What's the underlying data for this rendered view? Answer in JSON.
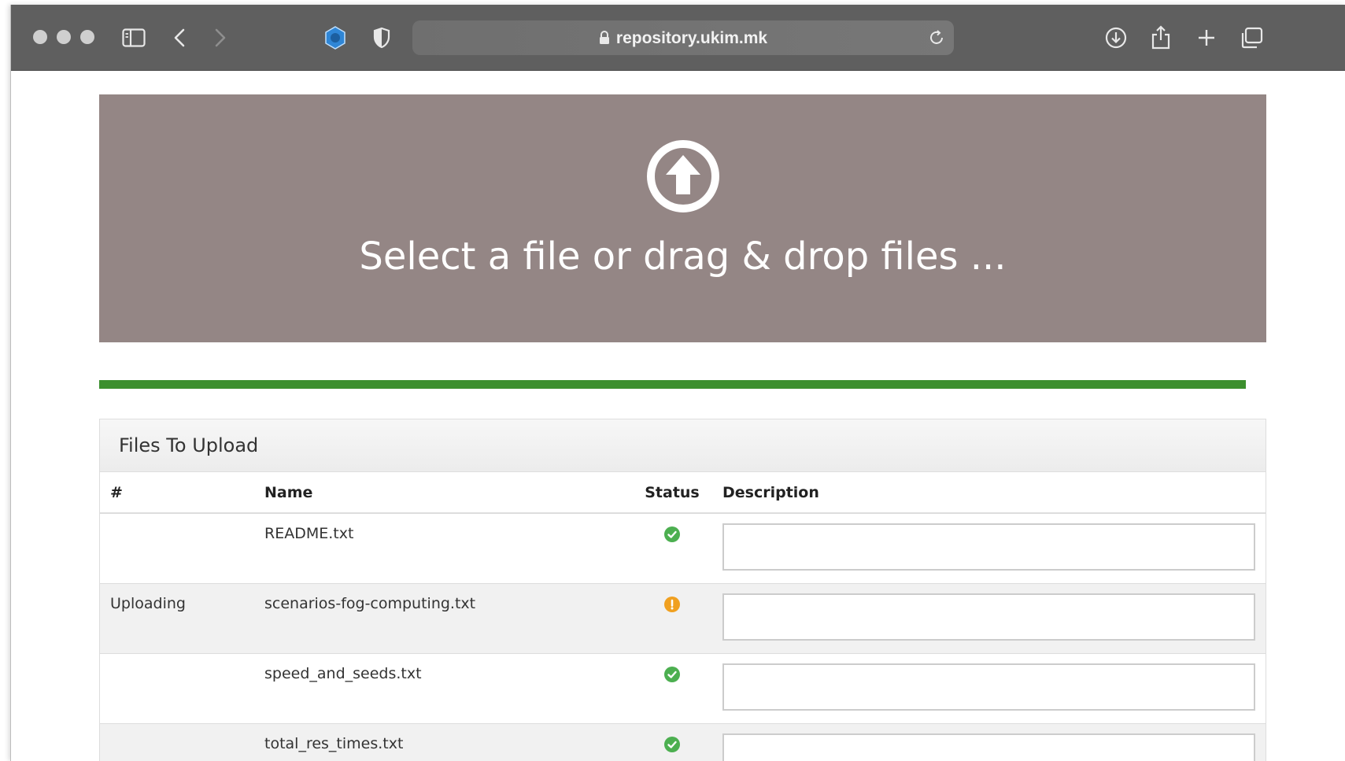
{
  "browser": {
    "url": "repository.ukim.mk",
    "traffic_color": "#cfcfcf"
  },
  "dropzone": {
    "text": "Select a file or drag & drop files ...",
    "background": "#948685"
  },
  "progress": {
    "fraction": 1.0,
    "color": "#3c8f2e"
  },
  "panel": {
    "title": "Files To Upload",
    "columns": {
      "index": "#",
      "name": "Name",
      "status": "Status",
      "description": "Description"
    },
    "rows": [
      {
        "index": "",
        "name": "README.txt",
        "status": "success",
        "status_color": "#4caf50",
        "description": ""
      },
      {
        "index": "Uploading",
        "name": "scenarios-fog-computing.txt",
        "status": "warning",
        "status_color": "#f0a020",
        "description": ""
      },
      {
        "index": "",
        "name": "speed_and_seeds.txt",
        "status": "success",
        "status_color": "#4caf50",
        "description": ""
      },
      {
        "index": "",
        "name": "total_res_times.txt",
        "status": "success",
        "status_color": "#4caf50",
        "description": ""
      }
    ]
  }
}
